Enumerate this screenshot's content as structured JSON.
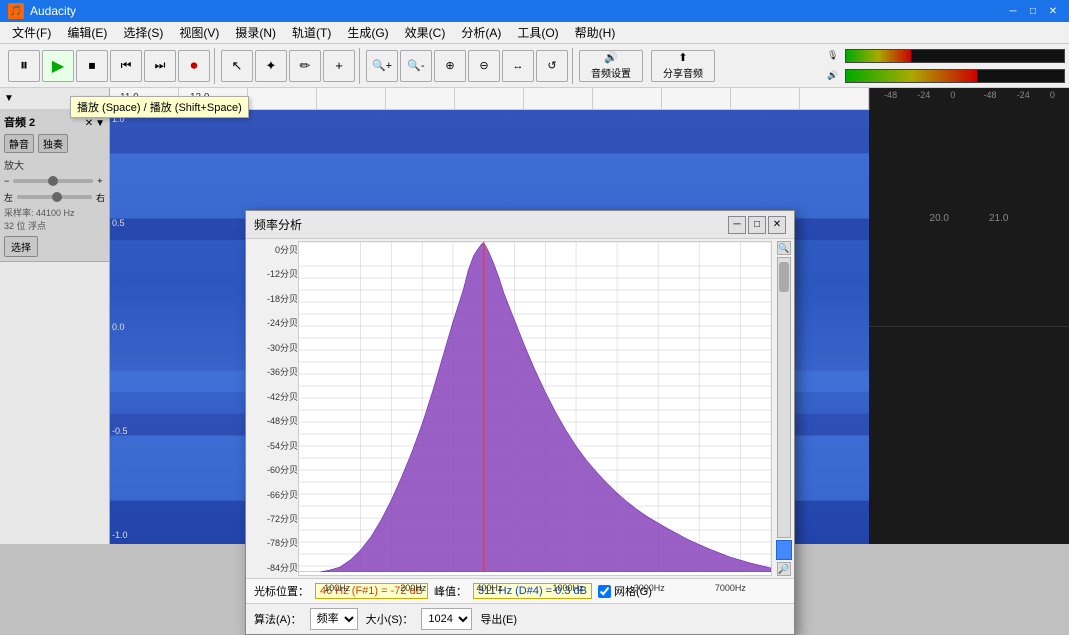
{
  "app": {
    "title": "Audacity",
    "icon": "🎵"
  },
  "titlebar": {
    "minimize": "─",
    "maximize": "□",
    "close": "✕"
  },
  "menu": {
    "items": [
      "文件(F)",
      "编辑(E)",
      "选择(S)",
      "视图(V)",
      "摄录(N)",
      "轨道(T)",
      "生成(G)",
      "效果(C)",
      "分析(A)",
      "工具(O)",
      "帮助(H)"
    ]
  },
  "toolbar": {
    "transport": {
      "pause": "⏸",
      "play": "▶",
      "stop": "⏹",
      "skip_back": "⏮",
      "skip_fwd": "⏭",
      "record": "⏺"
    },
    "tools": [
      "↖",
      "+",
      "✏",
      "✦"
    ],
    "zoom": [
      "🔍+",
      "🔍-",
      "⊕",
      "⊖",
      "↔",
      "↺"
    ],
    "audio_setup": "音频设置",
    "share": "分享音频"
  },
  "tooltip": {
    "text": "播放 (Space) / 播放 (Shift+Space)"
  },
  "ruler": {
    "marks": [
      "11.0",
      "13.0",
      "20.0",
      "21.0"
    ]
  },
  "track": {
    "name": "音频 2",
    "controls": [
      "静音",
      "独奏"
    ],
    "label": "放大",
    "scale_values": [
      "1.0",
      "0.5",
      "0.0",
      "-0.5",
      "-1.0"
    ],
    "gain_label": "左",
    "pan_label": "右",
    "sample_rate": "采样率: 44100 Hz",
    "bit_depth": "32 位 浮点",
    "select_btn": "选择"
  },
  "freq_dialog": {
    "title": "频率分析",
    "chart": {
      "y_labels": [
        "0分贝",
        "-12分贝",
        "-18分贝",
        "-24分贝",
        "-30分贝",
        "-36分贝",
        "-42分贝",
        "-48分贝",
        "-54分贝",
        "-60分贝",
        "-66分贝",
        "-72分贝",
        "-78分贝",
        "-84分贝"
      ],
      "x_labels": [
        "100Hz",
        "200Hz",
        "400Hz",
        "1000Hz",
        "3000Hz",
        "7000Hz"
      ]
    },
    "cursor_pos_label": "光标位置：",
    "cursor_value": "46 Hz (F#1) = -72 dB",
    "peak_label": "峰值：",
    "peak_value": "311 Hz (D#4) = 0.3 dB",
    "grid_label": "网格(G)",
    "algorithm_label": "算法(A)：",
    "algorithm_value": "频率",
    "size_label": "大小(S)：",
    "size_value": "1024",
    "export_label": "导出(E)"
  },
  "colors": {
    "waveform_fill": "#8844bb",
    "waveform_bg": "#3355aa",
    "peak_line": "#ff4444",
    "grid_line": "#cccccc",
    "chart_bg": "#ffffff",
    "toolbar_bg": "#f0f0f0",
    "title_bg": "#1a73e8",
    "track_bg": "#2244aa",
    "track_light": "#4477cc"
  }
}
